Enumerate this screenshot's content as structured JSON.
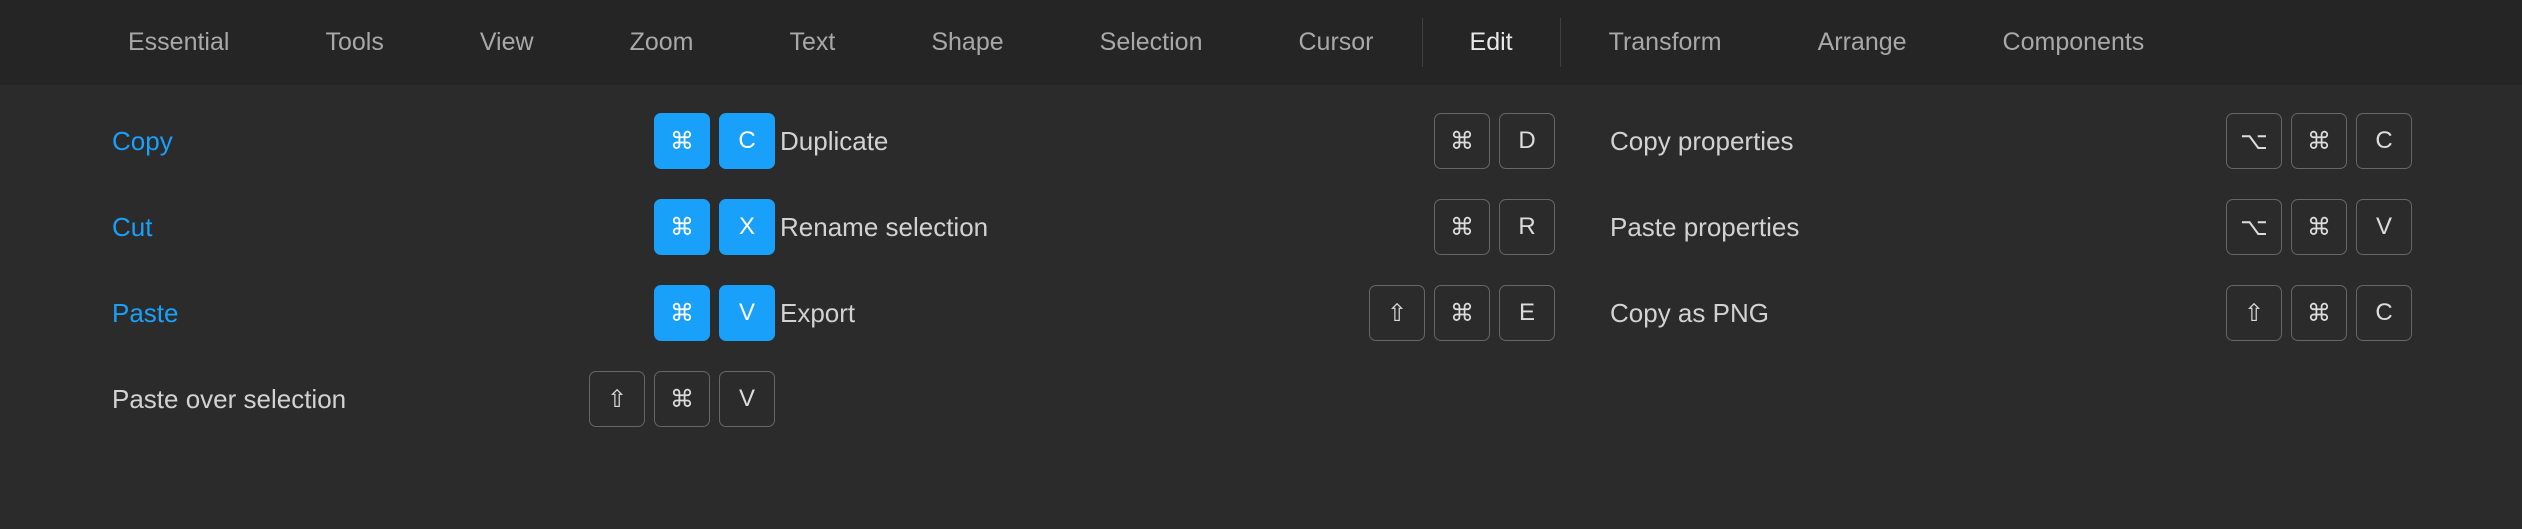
{
  "tabs": [
    {
      "label": "Essential",
      "active": false
    },
    {
      "label": "Tools",
      "active": false
    },
    {
      "label": "View",
      "active": false
    },
    {
      "label": "Zoom",
      "active": false
    },
    {
      "label": "Text",
      "active": false
    },
    {
      "label": "Shape",
      "active": false
    },
    {
      "label": "Selection",
      "active": false
    },
    {
      "label": "Cursor",
      "active": false
    },
    {
      "label": "Edit",
      "active": true
    },
    {
      "label": "Transform",
      "active": false
    },
    {
      "label": "Arrange",
      "active": false
    },
    {
      "label": "Components",
      "active": false
    }
  ],
  "symbols": {
    "cmd": "⌘",
    "shift": "⇧",
    "option": "⌥"
  },
  "columns": [
    {
      "items": [
        {
          "label": "Copy",
          "highlight": true,
          "keys": [
            {
              "sym": "cmd",
              "filled": true
            },
            {
              "text": "C",
              "filled": true
            }
          ]
        },
        {
          "label": "Cut",
          "highlight": true,
          "keys": [
            {
              "sym": "cmd",
              "filled": true
            },
            {
              "text": "X",
              "filled": true
            }
          ]
        },
        {
          "label": "Paste",
          "highlight": true,
          "keys": [
            {
              "sym": "cmd",
              "filled": true
            },
            {
              "text": "V",
              "filled": true
            }
          ]
        },
        {
          "label": "Paste over selection",
          "highlight": false,
          "keys": [
            {
              "sym": "shift"
            },
            {
              "sym": "cmd"
            },
            {
              "text": "V"
            }
          ]
        }
      ]
    },
    {
      "items": [
        {
          "label": "Duplicate",
          "highlight": false,
          "keys": [
            {
              "sym": "cmd"
            },
            {
              "text": "D"
            }
          ]
        },
        {
          "label": "Rename selection",
          "highlight": false,
          "keys": [
            {
              "sym": "cmd"
            },
            {
              "text": "R"
            }
          ]
        },
        {
          "label": "Export",
          "highlight": false,
          "keys": [
            {
              "sym": "shift"
            },
            {
              "sym": "cmd"
            },
            {
              "text": "E"
            }
          ]
        }
      ]
    },
    {
      "items": [
        {
          "label": "Copy properties",
          "highlight": false,
          "keys": [
            {
              "sym": "option"
            },
            {
              "sym": "cmd"
            },
            {
              "text": "C"
            }
          ]
        },
        {
          "label": "Paste properties",
          "highlight": false,
          "keys": [
            {
              "sym": "option"
            },
            {
              "sym": "cmd"
            },
            {
              "text": "V"
            }
          ]
        },
        {
          "label": "Copy as PNG",
          "highlight": false,
          "keys": [
            {
              "sym": "shift"
            },
            {
              "sym": "cmd"
            },
            {
              "text": "C"
            }
          ]
        }
      ]
    }
  ]
}
